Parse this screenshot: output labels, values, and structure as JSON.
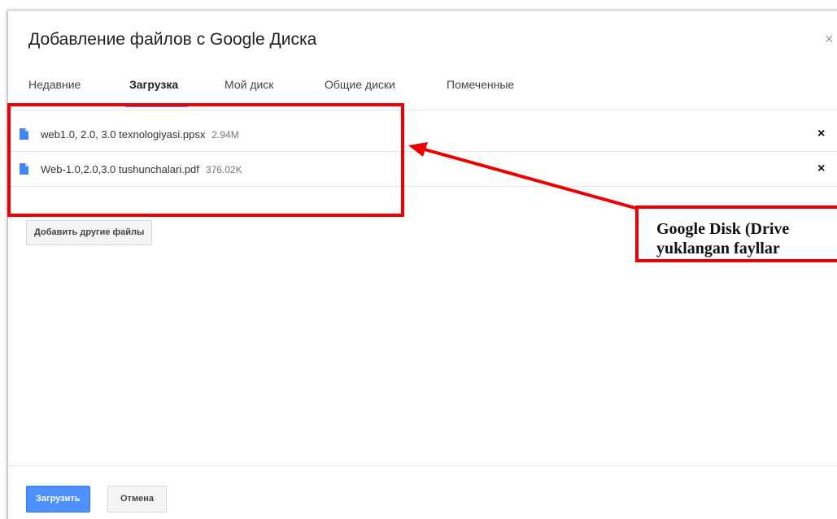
{
  "dialog": {
    "title": "Добавление файлов с Google Диска",
    "close_icon": "close-icon"
  },
  "tabs": [
    {
      "label": "Недавние",
      "active": false
    },
    {
      "label": "Загрузка",
      "active": true
    },
    {
      "label": "Мой диск",
      "active": false
    },
    {
      "label": "Общие диски",
      "active": false
    },
    {
      "label": "Помеченные",
      "active": false
    }
  ],
  "files": [
    {
      "name": "web1.0, 2.0, 3.0 texnologiyasi.ppsx",
      "size": "2.94M",
      "icon": "document-icon",
      "remove_icon": "×"
    },
    {
      "name": "Web-1.0,2.0,3.0 tushunchalari.pdf",
      "size": "376.02K",
      "icon": "document-icon",
      "remove_icon": "×"
    }
  ],
  "actions": {
    "add_more_label": "Добавить другие файлы",
    "upload_label": "Загрузить",
    "cancel_label": "Отмена"
  },
  "annotation": {
    "line1": "Google Disk (Drive",
    "line2": "yuklangan fayllar",
    "color": "#ee0000"
  },
  "colors": {
    "accent": "#4d90fe",
    "file_icon": "#4285f4"
  }
}
